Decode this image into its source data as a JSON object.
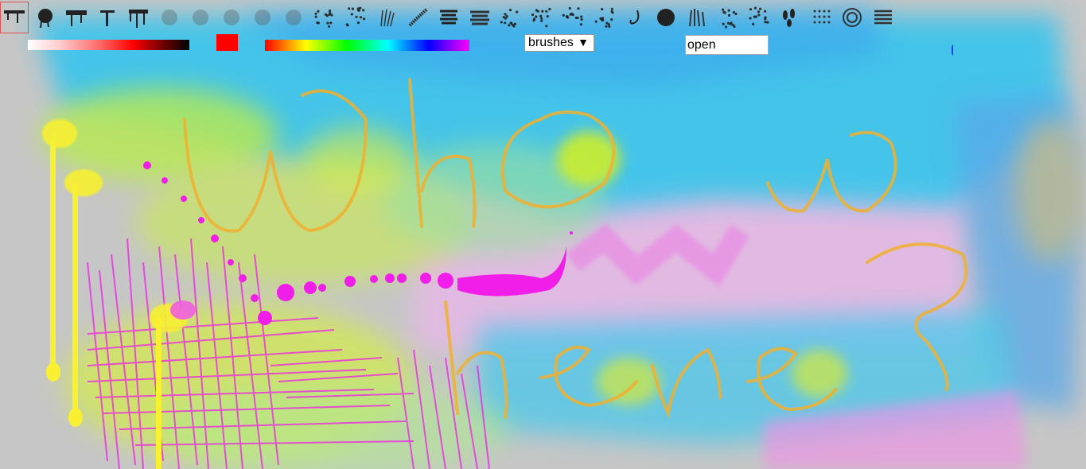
{
  "toolbar": {
    "brushes": [
      {
        "name": "brush-drip-1",
        "selected": true
      },
      {
        "name": "brush-splatter"
      },
      {
        "name": "brush-drip-2"
      },
      {
        "name": "brush-tbar"
      },
      {
        "name": "brush-drip-3"
      },
      {
        "name": "brush-soft-cloud-1"
      },
      {
        "name": "brush-soft-cloud-2"
      },
      {
        "name": "brush-soft-cloud-3"
      },
      {
        "name": "brush-soft-cloud-4"
      },
      {
        "name": "brush-soft-dots"
      },
      {
        "name": "brush-rough-dots"
      },
      {
        "name": "brush-sparkle"
      },
      {
        "name": "brush-fur"
      },
      {
        "name": "brush-feather"
      },
      {
        "name": "brush-streaks-1"
      },
      {
        "name": "brush-streaks-2"
      },
      {
        "name": "brush-scatter-1"
      },
      {
        "name": "brush-scatter-2"
      },
      {
        "name": "brush-scatter-3"
      },
      {
        "name": "brush-scatter-4"
      },
      {
        "name": "brush-hook"
      },
      {
        "name": "brush-round-blob"
      },
      {
        "name": "brush-grass"
      },
      {
        "name": "brush-dot-cluster"
      },
      {
        "name": "brush-line-scatter"
      },
      {
        "name": "brush-leaves"
      },
      {
        "name": "brush-dot-grid"
      },
      {
        "name": "brush-swirl"
      },
      {
        "name": "brush-lines"
      }
    ]
  },
  "colors": {
    "current": "#ff0000",
    "gradient_start": "#ffffff",
    "gradient_end": "#000000"
  },
  "brush_select": {
    "value": "brushes",
    "options": [
      "brushes"
    ]
  },
  "open_field": {
    "value": "open"
  }
}
